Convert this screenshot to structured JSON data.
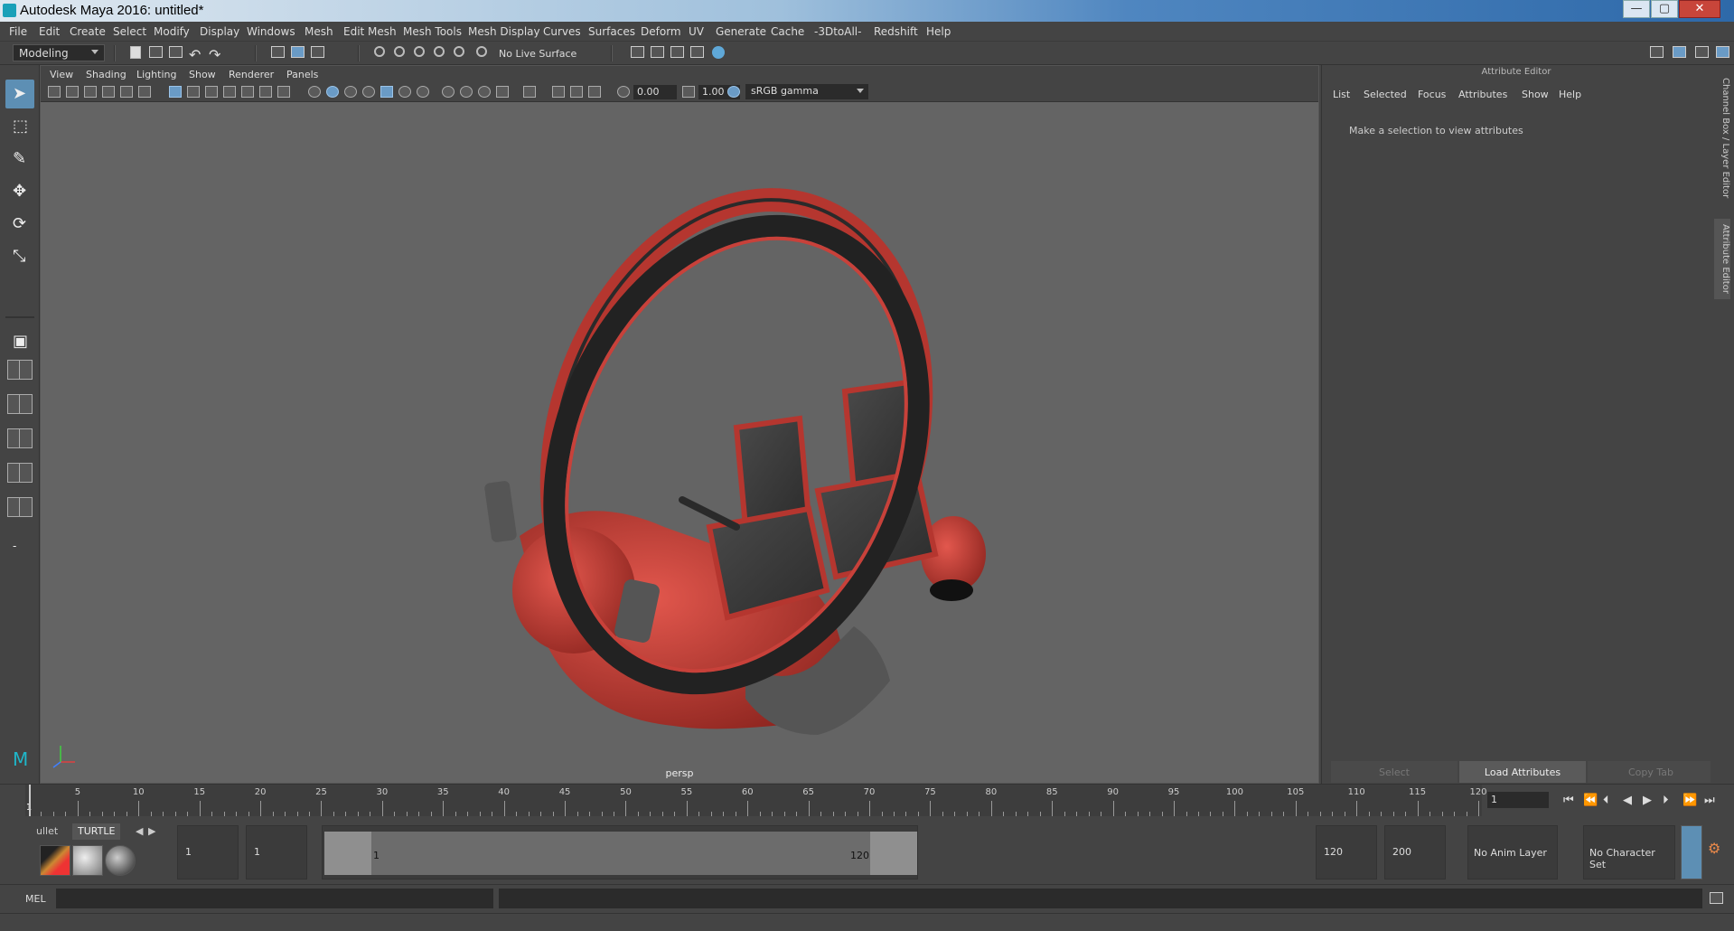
{
  "window": {
    "title": "Autodesk Maya 2016: untitled*",
    "minimize": "—",
    "maximize": "▢",
    "close": "✕"
  },
  "menu": [
    "File",
    "Edit",
    "Create",
    "Select",
    "Modify",
    "Display",
    "Windows",
    "Mesh",
    "Edit Mesh",
    "Mesh Tools",
    "Mesh Display",
    "Curves",
    "Surfaces",
    "Deform",
    "UV",
    "Generate",
    "Cache",
    "-3DtoAll-",
    "Redshift",
    "Help"
  ],
  "status": {
    "mode": "Modeling",
    "live_surface": "No Live Surface"
  },
  "viewport": {
    "menu": [
      "View",
      "Shading",
      "Lighting",
      "Show",
      "Renderer",
      "Panels"
    ],
    "exposure": "0.00",
    "gamma": "1.00",
    "color_space": "sRGB gamma",
    "camera_label": "persp"
  },
  "attribute_editor": {
    "header": "Attribute Editor",
    "menu": [
      "List",
      "Selected",
      "Focus",
      "Attributes",
      "Show",
      "Help"
    ],
    "message": "Make a selection to view attributes",
    "buttons": {
      "select": "Select",
      "load": "Load Attributes",
      "copy": "Copy Tab"
    },
    "side_tabs": {
      "channel": "Channel Box / Layer Editor",
      "attr": "Attribute Editor"
    }
  },
  "timeline": {
    "ticks": [
      1,
      5,
      10,
      15,
      20,
      25,
      30,
      35,
      40,
      45,
      50,
      55,
      60,
      65,
      70,
      75,
      80,
      85,
      90,
      95,
      100,
      105,
      110,
      115,
      120
    ],
    "current_frame": "1",
    "playback": [
      "⏮",
      "⏪",
      "⏴",
      "◀",
      "▶",
      "⏵",
      "⏩",
      "⏭"
    ]
  },
  "range": {
    "shelf_tabs": [
      "ullet",
      "TURTLE"
    ],
    "start": "1",
    "playback_start": "1",
    "range_start_label": "1",
    "range_end_label": "120",
    "playback_end": "120",
    "end": "200",
    "anim_layer": "No Anim Layer",
    "character_set": "No Character Set"
  },
  "command": {
    "language": "MEL"
  },
  "colors": {
    "ui_bg": "#444444",
    "viewport_bg": "#646464",
    "accent": "#5d8fb4",
    "model_red": "#c8413a",
    "model_black": "#2a2a2a"
  }
}
